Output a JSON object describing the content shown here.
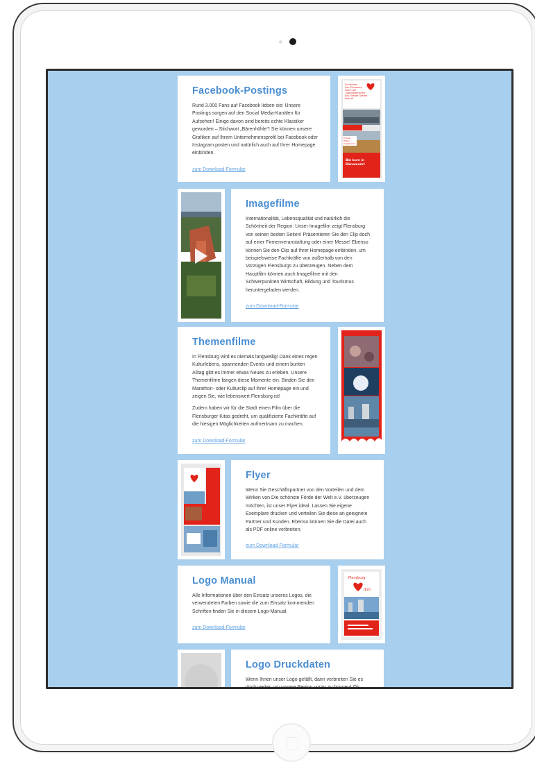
{
  "sections": [
    {
      "title": "Facebook-Postings",
      "paragraphs": [
        "Rund 3.000 Fans auf Facebook lieben sie: Unsere Postings sorgen auf den Social Media-Kanälen für Aufsehen! Einige davon sind bereits echte Klassiker geworden – Stichwort „Bärenhöhle\"! Sie können unsere Grafiken auf Ihrem Unternehmensprofil bei Facebook oder Instagram posten und natürlich auch auf Ihrer Homepage einbinden."
      ],
      "link": "zum Download-Formular",
      "thumbnail_icon": "social-post-collage-icon",
      "thumbnail_text": {
        "top": [
          "So kennen",
          "von Flensburg",
          "wenn die",
          "„Sandmännchen\"",
          "aus Ostsee Gebiet",
          "kommt"
        ],
        "mid": [
          "Einmal",
          "Hafen",
          "ringsherum"
        ],
        "bottom": [
          "Bin kurz in",
          "Dänemark!"
        ]
      }
    },
    {
      "title": "Imagefilme",
      "paragraphs": [
        "Internationalität, Lebensqualität und natürlich die Schönheit der Region: Unser Imagefilm zeigt Flensburg von seinen besten Seiten! Präsentieren Sie den Clip doch auf einer Firmenveranstaltung oder einer Messe! Ebenso können Sie den Clip auf Ihrer Homepage einbinden, um beispielsweise Fachkräfte von außerhalb von den Vorzügen Flensburgs zu überzeugen. Neben dem Hauptfilm können auch Imagefilme mit den Schwerpunkten Wirtschaft, Bildung und Tourismus heruntergeladen werden."
      ],
      "link": "zum Download-Formular",
      "thumbnail_icon": "play-icon"
    },
    {
      "title": "Themenfilme",
      "paragraphs": [
        "In Flensburg wird es niemals langweilig! Dank eines regen Kulturlebens, spannenden Events und einem bunten Alltag gibt es immer etwas Neues zu erleben. Unsere Themenfilme fangen diese Momente ein. Binden Sie den Marathon- oder Kulturclip auf Ihrer Homepage ein und zeigen Sie, wie lebenswert Flensburg ist!",
        "Zudem haben wir für die Stadt einen Film über die Flensburger Kitas gedreht, um qualifizierte Fachkräfte auf die hiesigen Möglichkeiten aufmerksam zu machen."
      ],
      "link": "zum Download-Formular",
      "thumbnail_icon": "film-strip-collage-icon"
    },
    {
      "title": "Flyer",
      "paragraphs": [
        "Wenn Sie Geschäftspartner von den Vorteilen und dem Wirken von Die schönste Förde der Welt e.V. überzeugen möchten, ist unser Flyer ideal. Lassen Sie eigene Exemplare drucken und verteilen Sie diese an geeignete Partner und Kunden. Ebenso können Sie die Datei auch als PDF online verbreiten."
      ],
      "link": "zum Download-Formular",
      "thumbnail_icon": "flyer-stack-icon"
    },
    {
      "title": "Logo Manual",
      "paragraphs": [
        "Alle Informationen über den Einsatz unseres Logos, die verwendeten Farben sowie die zum Einsatz kommenden Schriften finden Sie in diesem Logo-Manual."
      ],
      "link": "zum Download-Formular",
      "thumbnail_icon": "logo-manual-cover-icon",
      "thumbnail_text": {
        "logo": [
          "Flensburg",
          "dich"
        ]
      }
    },
    {
      "title": "Logo Druckdaten",
      "paragraphs": [
        "Wenn Ihnen unser Logo gefällt, dann verbreiten Sie es doch weiter, um unsere Region voran zu bringen! Ob"
      ],
      "link": "",
      "thumbnail_icon": "logo-print-data-icon"
    }
  ],
  "colors": {
    "screen_background": "#a8cfee",
    "title": "#4a8ed2",
    "link": "#5c9fe0",
    "body_text": "#3a3a3a",
    "brand_red": "#e2231a"
  }
}
